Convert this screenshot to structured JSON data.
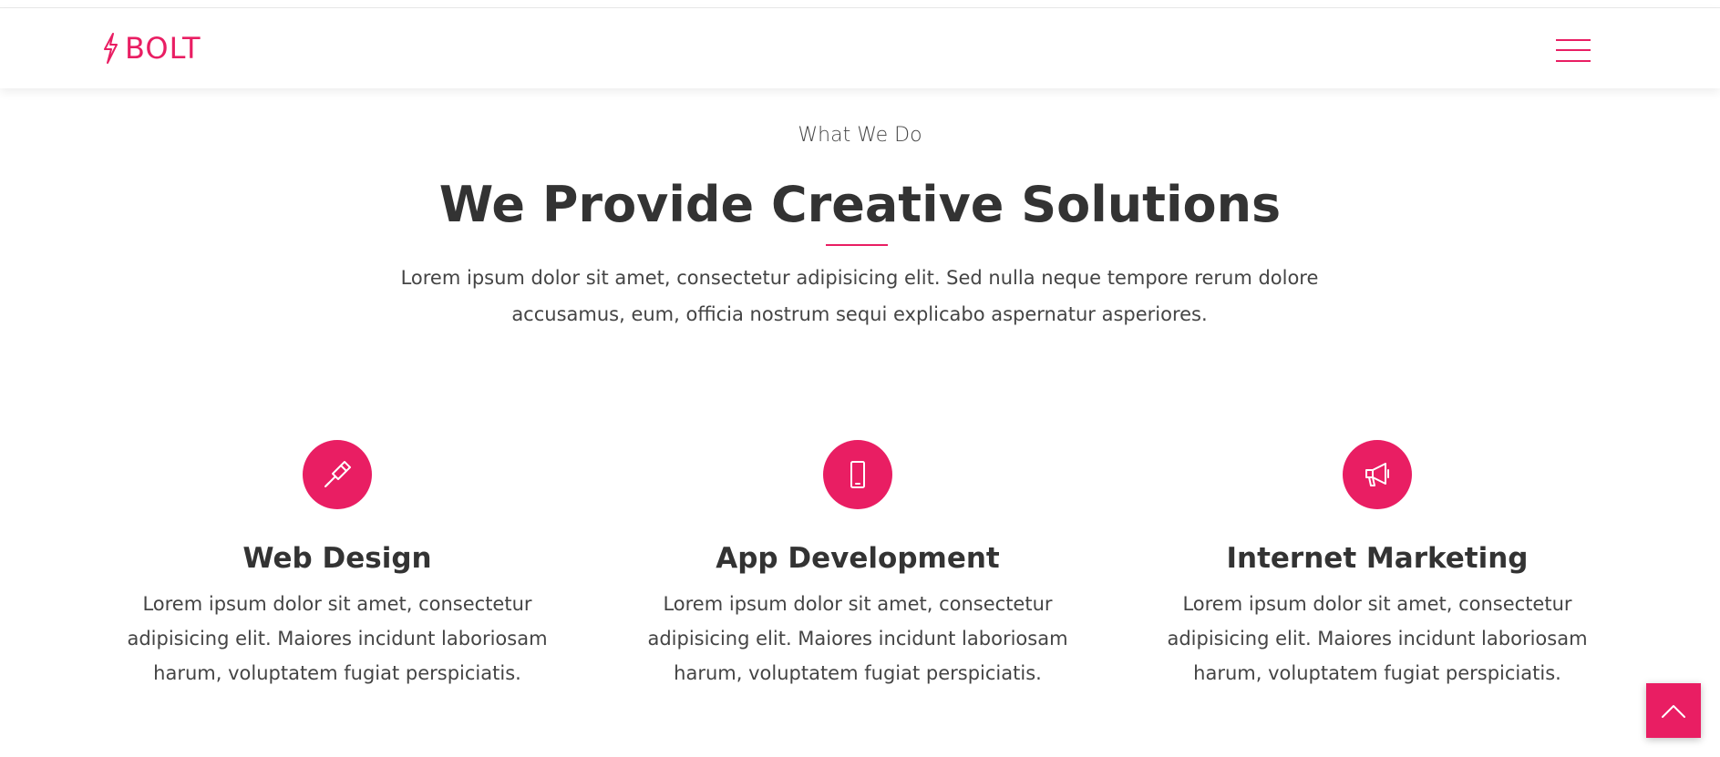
{
  "header": {
    "brand": "BOLT",
    "brand_icon": "lightning-bolt-icon",
    "menu_icon": "hamburger-menu-icon"
  },
  "section": {
    "eyebrow": "What We Do",
    "title": "We Provide Creative Solutions",
    "intro": "Lorem ipsum dolor sit amet, consectetur adipisicing elit. Sed nulla neque tempore rerum dolore accusamus, eum, officia nostrum sequi explicabo aspernatur asperiores."
  },
  "services": [
    {
      "icon": "paint-brush-icon",
      "title": "Web Design",
      "text": "Lorem ipsum dolor sit amet, consectetur adipisicing elit. Maiores incidunt laboriosam harum, voluptatem fugiat perspiciatis."
    },
    {
      "icon": "mobile-phone-icon",
      "title": "App Development",
      "text": "Lorem ipsum dolor sit amet, consectetur adipisicing elit. Maiores incidunt laboriosam harum, voluptatem fugiat perspiciatis."
    },
    {
      "icon": "megaphone-icon",
      "title": "Internet Marketing",
      "text": "Lorem ipsum dolor sit amet, consectetur adipisicing elit. Maiores incidunt laboriosam harum, voluptatem fugiat perspiciatis."
    }
  ],
  "scroll_top_icon": "chevron-up-icon",
  "colors": {
    "accent": "#e91e63",
    "heading": "#333333",
    "body_text": "#444444",
    "background": "#ffffff"
  }
}
